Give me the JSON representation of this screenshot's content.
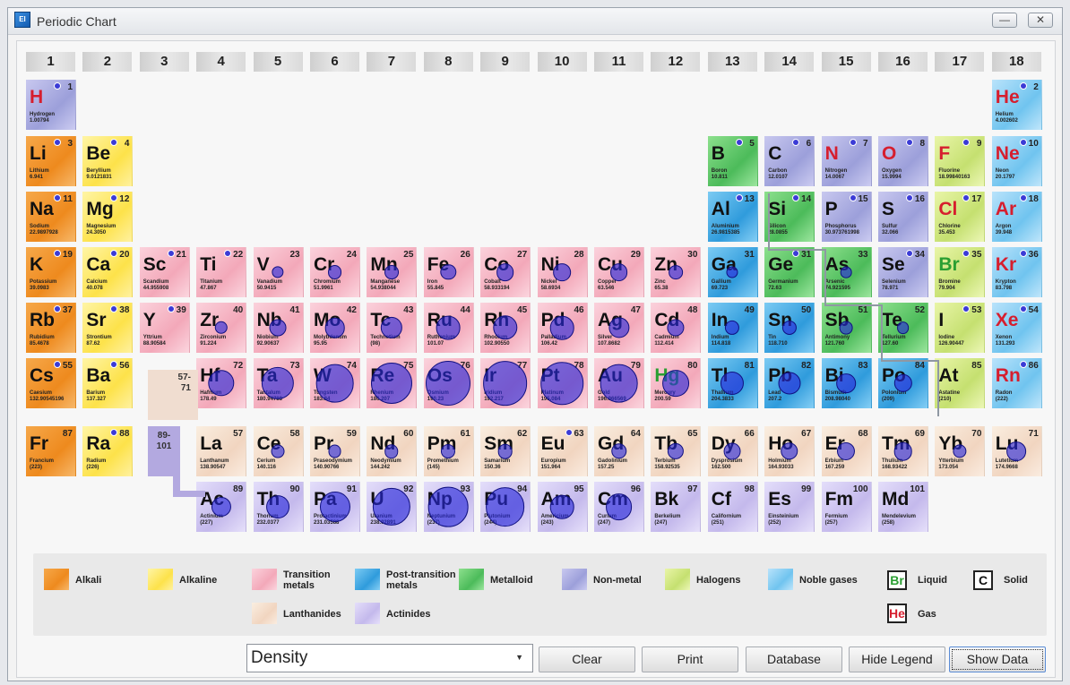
{
  "window": {
    "title": "Periodic Chart",
    "app_icon_text": "El",
    "minimize_label": "—",
    "close_label": "✕"
  },
  "groups": [
    "1",
    "2",
    "3",
    "4",
    "5",
    "6",
    "7",
    "8",
    "9",
    "10",
    "11",
    "12",
    "13",
    "14",
    "15",
    "16",
    "17",
    "18"
  ],
  "placeholders": {
    "lanthanide_range": "57-\n71",
    "actinide_range": "89-\n101"
  },
  "elements": [
    {
      "z": 1,
      "s": "H",
      "n": "Hydrogen",
      "m": "1.00794",
      "r": 1,
      "c": 1,
      "cat": "non",
      "st": "gas",
      "d": 0.0001
    },
    {
      "z": 2,
      "s": "He",
      "n": "Helium",
      "m": "4.002602",
      "r": 1,
      "c": 18,
      "cat": "nob",
      "st": "gas",
      "d": 0.0002
    },
    {
      "z": 3,
      "s": "Li",
      "n": "Lithium",
      "m": "6.941",
      "r": 2,
      "c": 1,
      "cat": "alk",
      "st": "sol",
      "d": 0.53
    },
    {
      "z": 4,
      "s": "Be",
      "n": "Beryllium",
      "m": "9.0121831",
      "r": 2,
      "c": 2,
      "cat": "ale",
      "st": "sol",
      "d": 1.85
    },
    {
      "z": 5,
      "s": "B",
      "n": "Boron",
      "m": "10.811",
      "r": 2,
      "c": 13,
      "cat": "met",
      "st": "sol",
      "d": 2.34
    },
    {
      "z": 6,
      "s": "C",
      "n": "Carbon",
      "m": "12.0107",
      "r": 2,
      "c": 14,
      "cat": "non",
      "st": "sol",
      "d": 2.27
    },
    {
      "z": 7,
      "s": "N",
      "n": "Nitrogen",
      "m": "14.0067",
      "r": 2,
      "c": 15,
      "cat": "non",
      "st": "gas",
      "d": 0.001
    },
    {
      "z": 8,
      "s": "O",
      "n": "Oxygen",
      "m": "15.9994",
      "r": 2,
      "c": 16,
      "cat": "non",
      "st": "gas",
      "d": 0.001
    },
    {
      "z": 9,
      "s": "F",
      "n": "Fluorine",
      "m": "18.99840163",
      "r": 2,
      "c": 17,
      "cat": "hal",
      "st": "gas",
      "d": 0.002
    },
    {
      "z": 10,
      "s": "Ne",
      "n": "Neon",
      "m": "20.1797",
      "r": 2,
      "c": 18,
      "cat": "nob",
      "st": "gas",
      "d": 0.001
    },
    {
      "z": 11,
      "s": "Na",
      "n": "Sodium",
      "m": "22.9897928",
      "r": 3,
      "c": 1,
      "cat": "alk",
      "st": "sol",
      "d": 0.97
    },
    {
      "z": 12,
      "s": "Mg",
      "n": "Magnesium",
      "m": "24.3050",
      "r": 3,
      "c": 2,
      "cat": "ale",
      "st": "sol",
      "d": 1.74
    },
    {
      "z": 13,
      "s": "Al",
      "n": "Aluminium",
      "m": "26.9815385",
      "r": 3,
      "c": 13,
      "cat": "pos",
      "st": "sol",
      "d": 2.7
    },
    {
      "z": 14,
      "s": "Si",
      "n": "Silicon",
      "m": "28.0855",
      "r": 3,
      "c": 14,
      "cat": "met",
      "st": "sol",
      "d": 2.33
    },
    {
      "z": 15,
      "s": "P",
      "n": "Phosphorus",
      "m": "30.973761998",
      "r": 3,
      "c": 15,
      "cat": "non",
      "st": "sol",
      "d": 1.82
    },
    {
      "z": 16,
      "s": "S",
      "n": "Sulfur",
      "m": "32.066",
      "r": 3,
      "c": 16,
      "cat": "non",
      "st": "sol",
      "d": 2.07
    },
    {
      "z": 17,
      "s": "Cl",
      "n": "Chlorine",
      "m": "35.453",
      "r": 3,
      "c": 17,
      "cat": "hal",
      "st": "gas",
      "d": 0.003
    },
    {
      "z": 18,
      "s": "Ar",
      "n": "Argon",
      "m": "39.948",
      "r": 3,
      "c": 18,
      "cat": "nob",
      "st": "gas",
      "d": 0.002
    },
    {
      "z": 19,
      "s": "K",
      "n": "Potassium",
      "m": "39.0983",
      "r": 4,
      "c": 1,
      "cat": "alk",
      "st": "sol",
      "d": 0.86
    },
    {
      "z": 20,
      "s": "Ca",
      "n": "Calcium",
      "m": "40.078",
      "r": 4,
      "c": 2,
      "cat": "ale",
      "st": "sol",
      "d": 1.55
    },
    {
      "z": 21,
      "s": "Sc",
      "n": "Scandium",
      "m": "44.955908",
      "r": 4,
      "c": 3,
      "cat": "tra",
      "st": "sol",
      "d": 2.99
    },
    {
      "z": 22,
      "s": "Ti",
      "n": "Titanium",
      "m": "47.867",
      "r": 4,
      "c": 4,
      "cat": "tra",
      "st": "sol",
      "d": 4.5
    },
    {
      "z": 23,
      "s": "V",
      "n": "Vanadium",
      "m": "50.9415",
      "r": 4,
      "c": 5,
      "cat": "tra",
      "st": "sol",
      "d": 6.0
    },
    {
      "z": 24,
      "s": "Cr",
      "n": "Chromium",
      "m": "51.9961",
      "r": 4,
      "c": 6,
      "cat": "tra",
      "st": "sol",
      "d": 7.19
    },
    {
      "z": 25,
      "s": "Mn",
      "n": "Manganese",
      "m": "54.938044",
      "r": 4,
      "c": 7,
      "cat": "tra",
      "st": "sol",
      "d": 7.21
    },
    {
      "z": 26,
      "s": "Fe",
      "n": "Iron",
      "m": "55.845",
      "r": 4,
      "c": 8,
      "cat": "tra",
      "st": "sol",
      "d": 7.87
    },
    {
      "z": 27,
      "s": "Co",
      "n": "Cobalt",
      "m": "58.933194",
      "r": 4,
      "c": 9,
      "cat": "tra",
      "st": "sol",
      "d": 8.9
    },
    {
      "z": 28,
      "s": "Ni",
      "n": "Nickel",
      "m": "58.6934",
      "r": 4,
      "c": 10,
      "cat": "tra",
      "st": "sol",
      "d": 8.9
    },
    {
      "z": 29,
      "s": "Cu",
      "n": "Copper",
      "m": "63.546",
      "r": 4,
      "c": 11,
      "cat": "tra",
      "st": "sol",
      "d": 8.96
    },
    {
      "z": 30,
      "s": "Zn",
      "n": "Zinc",
      "m": "65.38",
      "r": 4,
      "c": 12,
      "cat": "tra",
      "st": "sol",
      "d": 7.13
    },
    {
      "z": 31,
      "s": "Ga",
      "n": "Gallium",
      "m": "69.723",
      "r": 4,
      "c": 13,
      "cat": "pos",
      "st": "sol",
      "d": 5.91
    },
    {
      "z": 31,
      "s": "Ge",
      "n": "Germanium",
      "m": "72.63",
      "r": 4,
      "c": 14,
      "cat": "met",
      "st": "sol",
      "d": 5.32
    },
    {
      "z": 33,
      "s": "As",
      "n": "Arsenic",
      "m": "74.921595",
      "r": 4,
      "c": 15,
      "cat": "met",
      "st": "sol",
      "d": 5.73
    },
    {
      "z": 34,
      "s": "Se",
      "n": "Selenium",
      "m": "78.971",
      "r": 4,
      "c": 16,
      "cat": "non",
      "st": "sol",
      "d": 4.81
    },
    {
      "z": 35,
      "s": "Br",
      "n": "Bromine",
      "m": "79.904",
      "r": 4,
      "c": 17,
      "cat": "hal",
      "st": "liq",
      "d": 3.1
    },
    {
      "z": 36,
      "s": "Kr",
      "n": "Krypton",
      "m": "83.798",
      "r": 4,
      "c": 18,
      "cat": "nob",
      "st": "gas",
      "d": 0.004
    },
    {
      "z": 37,
      "s": "Rb",
      "n": "Rubidium",
      "m": "85.4678",
      "r": 5,
      "c": 1,
      "cat": "alk",
      "st": "sol",
      "d": 1.53
    },
    {
      "z": 38,
      "s": "Sr",
      "n": "Strontium",
      "m": "87.62",
      "r": 5,
      "c": 2,
      "cat": "ale",
      "st": "sol",
      "d": 2.64
    },
    {
      "z": 39,
      "s": "Y",
      "n": "Yttrium",
      "m": "88.90584",
      "r": 5,
      "c": 3,
      "cat": "tra",
      "st": "sol",
      "d": 4.47
    },
    {
      "z": 40,
      "s": "Zr",
      "n": "Zirconium",
      "m": "91.224",
      "r": 5,
      "c": 4,
      "cat": "tra",
      "st": "sol",
      "d": 6.52
    },
    {
      "z": 41,
      "s": "Nb",
      "n": "Niobium",
      "m": "92.90637",
      "r": 5,
      "c": 5,
      "cat": "tra",
      "st": "sol",
      "d": 8.57
    },
    {
      "z": 42,
      "s": "Mo",
      "n": "Molybdenum",
      "m": "95.95",
      "r": 5,
      "c": 6,
      "cat": "tra",
      "st": "sol",
      "d": 10.2
    },
    {
      "z": 43,
      "s": "Tc",
      "n": "Technetium",
      "m": "(98)",
      "r": 5,
      "c": 7,
      "cat": "tra",
      "st": "sol",
      "d": 11.0
    },
    {
      "z": 44,
      "s": "Ru",
      "n": "Ruthenium",
      "m": "101.07",
      "r": 5,
      "c": 8,
      "cat": "tra",
      "st": "sol",
      "d": 12.1
    },
    {
      "z": 45,
      "s": "Rh",
      "n": "Rhodium",
      "m": "102.90550",
      "r": 5,
      "c": 9,
      "cat": "tra",
      "st": "sol",
      "d": 12.4
    },
    {
      "z": 46,
      "s": "Pd",
      "n": "Palladium",
      "m": "106.42",
      "r": 5,
      "c": 10,
      "cat": "tra",
      "st": "sol",
      "d": 12.0
    },
    {
      "z": 47,
      "s": "Ag",
      "n": "Silver",
      "m": "107.8682",
      "r": 5,
      "c": 11,
      "cat": "tra",
      "st": "sol",
      "d": 10.5
    },
    {
      "z": 48,
      "s": "Cd",
      "n": "Cadmium",
      "m": "112.414",
      "r": 5,
      "c": 12,
      "cat": "tra",
      "st": "sol",
      "d": 8.65
    },
    {
      "z": 49,
      "s": "In",
      "n": "Indium",
      "m": "114.818",
      "r": 5,
      "c": 13,
      "cat": "pos",
      "st": "sol",
      "d": 7.31
    },
    {
      "z": 50,
      "s": "Sn",
      "n": "Tin",
      "m": "118.710",
      "r": 5,
      "c": 14,
      "cat": "pos",
      "st": "sol",
      "d": 7.29
    },
    {
      "z": 51,
      "s": "Sb",
      "n": "Antimony",
      "m": "121.760",
      "r": 5,
      "c": 15,
      "cat": "met",
      "st": "sol",
      "d": 6.68
    },
    {
      "z": 52,
      "s": "Te",
      "n": "Tellurium",
      "m": "127.60",
      "r": 5,
      "c": 16,
      "cat": "met",
      "st": "sol",
      "d": 6.24
    },
    {
      "z": 53,
      "s": "I",
      "n": "Iodine",
      "m": "126.90447",
      "r": 5,
      "c": 17,
      "cat": "hal",
      "st": "sol",
      "d": 4.93
    },
    {
      "z": 54,
      "s": "Xe",
      "n": "Xenon",
      "m": "131.293",
      "r": 5,
      "c": 18,
      "cat": "nob",
      "st": "gas",
      "d": 0.006
    },
    {
      "z": 55,
      "s": "Cs",
      "n": "Caesium",
      "m": "132.90545196",
      "r": 6,
      "c": 1,
      "cat": "alk",
      "st": "sol",
      "d": 1.93
    },
    {
      "z": 56,
      "s": "Ba",
      "n": "Barium",
      "m": "137.327",
      "r": 6,
      "c": 2,
      "cat": "ale",
      "st": "sol",
      "d": 3.62
    },
    {
      "z": 72,
      "s": "Hf",
      "n": "Hafnium",
      "m": "178.49",
      "r": 6,
      "c": 4,
      "cat": "tra",
      "st": "sol",
      "d": 13.3
    },
    {
      "z": 73,
      "s": "Ta",
      "n": "Tantalum",
      "m": "180.94788",
      "r": 6,
      "c": 5,
      "cat": "tra",
      "st": "sol",
      "d": 16.4
    },
    {
      "z": 74,
      "s": "W",
      "n": "Tungsten",
      "m": "183.84",
      "r": 6,
      "c": 6,
      "cat": "tra",
      "st": "sol",
      "d": 19.3
    },
    {
      "z": 75,
      "s": "Re",
      "n": "Rhenium",
      "m": "186.207",
      "r": 6,
      "c": 7,
      "cat": "tra",
      "st": "sol",
      "d": 20.8
    },
    {
      "z": 76,
      "s": "Os",
      "n": "Osmium",
      "m": "190.23",
      "r": 6,
      "c": 8,
      "cat": "tra",
      "st": "sol",
      "d": 22.6
    },
    {
      "z": 77,
      "s": "Ir",
      "n": "Iridium",
      "m": "192.217",
      "r": 6,
      "c": 9,
      "cat": "tra",
      "st": "sol",
      "d": 22.5
    },
    {
      "z": 78,
      "s": "Pt",
      "n": "Platinum",
      "m": "195.084",
      "r": 6,
      "c": 10,
      "cat": "tra",
      "st": "sol",
      "d": 21.5
    },
    {
      "z": 79,
      "s": "Au",
      "n": "Gold",
      "m": "196.966569",
      "r": 6,
      "c": 11,
      "cat": "tra",
      "st": "sol",
      "d": 19.3
    },
    {
      "z": 80,
      "s": "Hg",
      "n": "Mercury",
      "m": "200.59",
      "r": 6,
      "c": 12,
      "cat": "tra",
      "st": "liq",
      "d": 13.5
    },
    {
      "z": 81,
      "s": "Tl",
      "n": "Thallium",
      "m": "204.3833",
      "r": 6,
      "c": 13,
      "cat": "pos",
      "st": "sol",
      "d": 11.8
    },
    {
      "z": 82,
      "s": "Pb",
      "n": "Lead",
      "m": "207.2",
      "r": 6,
      "c": 14,
      "cat": "pos",
      "st": "sol",
      "d": 11.3
    },
    {
      "z": 83,
      "s": "Bi",
      "n": "Bismuth",
      "m": "208.98040",
      "r": 6,
      "c": 15,
      "cat": "pos",
      "st": "sol",
      "d": 9.79
    },
    {
      "z": 84,
      "s": "Po",
      "n": "Polonium",
      "m": "(209)",
      "r": 6,
      "c": 16,
      "cat": "pos",
      "st": "sol",
      "d": 9.2
    },
    {
      "z": 85,
      "s": "At",
      "n": "Astatine",
      "m": "(210)",
      "r": 6,
      "c": 17,
      "cat": "hal",
      "st": "sol",
      "d": 0
    },
    {
      "z": 86,
      "s": "Rn",
      "n": "Radon",
      "m": "(222)",
      "r": 6,
      "c": 18,
      "cat": "nob",
      "st": "gas",
      "d": 0.01
    },
    {
      "z": 87,
      "s": "Fr",
      "n": "Francium",
      "m": "(223)",
      "r": 7,
      "c": 1,
      "cat": "alk",
      "st": "sol",
      "d": 0
    },
    {
      "z": 88,
      "s": "Ra",
      "n": "Radium",
      "m": "(226)",
      "r": 7,
      "c": 2,
      "cat": "ale",
      "st": "sol",
      "d": 5.0
    },
    {
      "z": 57,
      "s": "La",
      "n": "Lanthanum",
      "m": "138.90547",
      "r": 7,
      "c": 4,
      "cat": "lan",
      "st": "sol",
      "d": 0
    },
    {
      "z": 58,
      "s": "Ce",
      "n": "Cerium",
      "m": "140.116",
      "r": 7,
      "c": 5,
      "cat": "lan",
      "st": "sol",
      "d": 6.77
    },
    {
      "z": 59,
      "s": "Pr",
      "n": "Praseodymium",
      "m": "140.90766",
      "r": 7,
      "c": 6,
      "cat": "lan",
      "st": "sol",
      "d": 6.77
    },
    {
      "z": 60,
      "s": "Nd",
      "n": "Neodymium",
      "m": "144.242",
      "r": 7,
      "c": 7,
      "cat": "lan",
      "st": "sol",
      "d": 7.01
    },
    {
      "z": 61,
      "s": "Pm",
      "n": "Promethium",
      "m": "(145)",
      "r": 7,
      "c": 8,
      "cat": "lan",
      "st": "sol",
      "d": 7.26
    },
    {
      "z": 62,
      "s": "Sm",
      "n": "Samarium",
      "m": "150.36",
      "r": 7,
      "c": 9,
      "cat": "lan",
      "st": "sol",
      "d": 7.52
    },
    {
      "z": 63,
      "s": "Eu",
      "n": "Europium",
      "m": "151.964",
      "r": 7,
      "c": 10,
      "cat": "lan",
      "st": "sol",
      "d": 5.24
    },
    {
      "z": 64,
      "s": "Gd",
      "n": "Gadolinium",
      "m": "157.25",
      "r": 7,
      "c": 11,
      "cat": "lan",
      "st": "sol",
      "d": 7.9
    },
    {
      "z": 65,
      "s": "Tb",
      "n": "Terbium",
      "m": "158.92535",
      "r": 7,
      "c": 12,
      "cat": "lan",
      "st": "sol",
      "d": 8.23
    },
    {
      "z": 66,
      "s": "Dy",
      "n": "Dysprosium",
      "m": "162.500",
      "r": 7,
      "c": 13,
      "cat": "lan",
      "st": "sol",
      "d": 8.55
    },
    {
      "z": 67,
      "s": "Ho",
      "n": "Holmium",
      "m": "164.93033",
      "r": 7,
      "c": 14,
      "cat": "lan",
      "st": "sol",
      "d": 8.8
    },
    {
      "z": 68,
      "s": "Er",
      "n": "Erbium",
      "m": "167.259",
      "r": 7,
      "c": 15,
      "cat": "lan",
      "st": "sol",
      "d": 9.07
    },
    {
      "z": 69,
      "s": "Tm",
      "n": "Thulium",
      "m": "168.93422",
      "r": 7,
      "c": 16,
      "cat": "lan",
      "st": "sol",
      "d": 9.32
    },
    {
      "z": 70,
      "s": "Yb",
      "n": "Ytterbium",
      "m": "173.054",
      "r": 7,
      "c": 17,
      "cat": "lan",
      "st": "sol",
      "d": 6.9
    },
    {
      "z": 71,
      "s": "Lu",
      "n": "Lutetium",
      "m": "174.9668",
      "r": 7,
      "c": 18,
      "cat": "lan",
      "st": "sol",
      "d": 9.84
    },
    {
      "z": 89,
      "s": "Ac",
      "n": "Actinium",
      "m": "(227)",
      "r": 8,
      "c": 4,
      "cat": "act",
      "st": "sol",
      "d": 10.0
    },
    {
      "z": 90,
      "s": "Th",
      "n": "Thorium",
      "m": "232.0377",
      "r": 8,
      "c": 5,
      "cat": "act",
      "st": "sol",
      "d": 11.7
    },
    {
      "z": 91,
      "s": "Pa",
      "n": "Protactinium",
      "m": "231.03588",
      "r": 8,
      "c": 6,
      "cat": "act",
      "st": "sol",
      "d": 15.4
    },
    {
      "z": 92,
      "s": "U",
      "n": "Uranium",
      "m": "238.02891",
      "r": 8,
      "c": 7,
      "cat": "act",
      "st": "sol",
      "d": 19.1
    },
    {
      "z": 93,
      "s": "Np",
      "n": "Neptunium",
      "m": "(237)",
      "r": 8,
      "c": 8,
      "cat": "act",
      "st": "sol",
      "d": 20.2
    },
    {
      "z": 94,
      "s": "Pu",
      "n": "Plutonium",
      "m": "(244)",
      "r": 8,
      "c": 9,
      "cat": "act",
      "st": "sol",
      "d": 19.8
    },
    {
      "z": 95,
      "s": "Am",
      "n": "Americium",
      "m": "(243)",
      "r": 8,
      "c": 10,
      "cat": "act",
      "st": "sol",
      "d": 12.0
    },
    {
      "z": 96,
      "s": "Cm",
      "n": "Curium",
      "m": "(247)",
      "r": 8,
      "c": 11,
      "cat": "act",
      "st": "sol",
      "d": 13.5
    },
    {
      "z": 97,
      "s": "Bk",
      "n": "Berkelium",
      "m": "(247)",
      "r": 8,
      "c": 12,
      "cat": "act",
      "st": "sol",
      "d": 0
    },
    {
      "z": 98,
      "s": "Cf",
      "n": "Californium",
      "m": "(251)",
      "r": 8,
      "c": 13,
      "cat": "act",
      "st": "sol",
      "d": 0
    },
    {
      "z": 99,
      "s": "Es",
      "n": "Einsteinium",
      "m": "(252)",
      "r": 8,
      "c": 14,
      "cat": "act",
      "st": "sol",
      "d": 0
    },
    {
      "z": 100,
      "s": "Fm",
      "n": "Fermium",
      "m": "(257)",
      "r": 8,
      "c": 15,
      "cat": "act",
      "st": "sol",
      "d": 0
    },
    {
      "z": 101,
      "s": "Md",
      "n": "Mendelevium",
      "m": "(258)",
      "r": 8,
      "c": 16,
      "cat": "act",
      "st": "sol",
      "d": 0
    }
  ],
  "legend": {
    "alkali": "Alkali",
    "alkaline": "Alkaline",
    "transition": "Transition\nmetals",
    "post_transition": "Post-transition\nmetals",
    "metalloid": "Metalloid",
    "non_metal": "Non-metal",
    "halogens": "Halogens",
    "noble": "Noble gases",
    "lanthanides": "Lanthanides",
    "actinides": "Actinides",
    "liquid_symbol": "Br",
    "liquid": "Liquid",
    "solid_symbol": "C",
    "solid": "Solid",
    "gas_symbol": "He",
    "gas": "Gas"
  },
  "controls": {
    "property_select": "Density",
    "clear": "Clear",
    "print": "Print",
    "database": "Database",
    "hide_legend": "Hide Legend",
    "show_data": "Show Data"
  }
}
